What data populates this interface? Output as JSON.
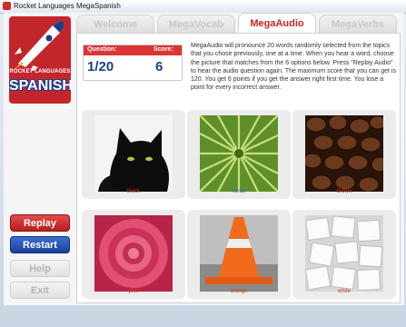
{
  "window": {
    "title": "Rocket Languages MegaSpanish"
  },
  "brand": {
    "top_line": "ROCKET LANGUAGES",
    "main": "SPANISH"
  },
  "sidebar": {
    "buttons": [
      {
        "label": "Replay Audio"
      },
      {
        "label": "Restart"
      },
      {
        "label": "Help"
      },
      {
        "label": "Exit"
      }
    ]
  },
  "tabs": [
    {
      "label": "Welcome",
      "active": false
    },
    {
      "label": "MegaVocab",
      "active": false
    },
    {
      "label": "MegaAudio",
      "active": true
    },
    {
      "label": "MegaVerbs",
      "active": false
    }
  ],
  "score": {
    "question_label": "Question:",
    "score_label": "Score:",
    "question_value": "1/20",
    "score_value": "6"
  },
  "instructions": "MegaAudio will pronounce 20 words randomly selected from the topics that you chose previously, one at a time. When you hear a word, choose the picture that matches from the 6 options below. Press \"Replay Audio\" to hear the audio question again. The maximum score that you can get is 120. You get 6 points if you get the answer right first time. You lose a point for every incorrect answer.",
  "cards": [
    {
      "caption": "black",
      "image": "black-cat"
    },
    {
      "caption": "verde",
      "image": "green-palm-leaves"
    },
    {
      "caption": "brown",
      "image": "coffee-beans"
    },
    {
      "caption": "pink",
      "image": "pink-rose"
    },
    {
      "caption": "orange",
      "image": "traffic-cone"
    },
    {
      "caption": "white",
      "image": "sugar-cubes"
    }
  ],
  "colors": {
    "accent_red": "#dc3535",
    "accent_blue": "#1b3e8f",
    "caption_orange": "#d2401d",
    "caption_blue": "#3866c7"
  }
}
